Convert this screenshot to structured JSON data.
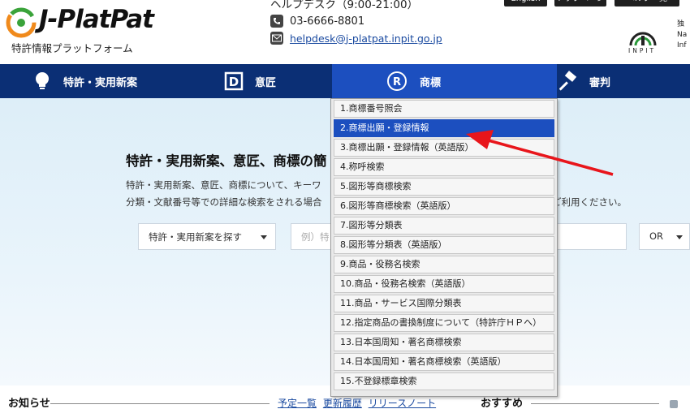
{
  "header": {
    "logo_text": "J-PlatPat",
    "logo_subtitle": "特許情報プラットフォーム",
    "helpdesk_label": "ヘルプデスク（9:00-21:00）",
    "tel": "03-6666-8801",
    "email": "helpdesk@j-platpat.inpit.go.jp",
    "top_buttons": [
      "English",
      "トップページ",
      "ヘルプ一覧"
    ],
    "inpit_label": "INPIT",
    "inpit_side": [
      "独",
      "Na",
      "Inf"
    ]
  },
  "nav": {
    "items": [
      {
        "label": "特許・実用新案",
        "icon": "lightbulb-icon"
      },
      {
        "label": "意匠",
        "icon": "design-icon"
      },
      {
        "label": "商標",
        "icon": "registered-icon"
      },
      {
        "label": "審判",
        "icon": "gavel-icon"
      }
    ],
    "active": "商標"
  },
  "main": {
    "title": "特許・実用新案、意匠、商標の簡",
    "desc_line1": "特許・実用新案、意匠、商標について、キーワ",
    "desc_line2": "分類・文献番号等での詳細な検索をされる場合",
    "desc_line2_tail": "ご利用ください。",
    "search_select": "特許・実用新案を探す",
    "search_placeholder": "例）特",
    "or_select": "OR"
  },
  "dropdown": {
    "items": [
      "1.商標番号照会",
      "2.商標出願・登録情報",
      "3.商標出願・登録情報（英語版）",
      "4.称呼検索",
      "5.図形等商標検索",
      "6.図形等商標検索（英語版）",
      "7.図形等分類表",
      "8.図形等分類表（英語版）",
      "9.商品・役務名検索",
      "10.商品・役務名検索（英語版）",
      "11.商品・サービス国際分類表",
      "12.指定商品の書換制度について（特許庁ＨＰへ）",
      "13.日本国周知・著名商標検索",
      "14.日本国周知・著名商標検索（英語版）",
      "15.不登録標章検索"
    ],
    "selected_index": 1
  },
  "bottom": {
    "news_title": "お知らせ",
    "news_links": [
      "予定一覧",
      "更新履歴",
      "リリースノート"
    ],
    "recommend_title": "おすすめ"
  },
  "colors": {
    "nav_bg": "#0b2f75",
    "nav_active": "#1c4fbf",
    "selected_item": "#1c4fbf",
    "annotation_arrow": "#e8151b",
    "logo_orange": "#f08a1c",
    "logo_green": "#3aa33a"
  }
}
